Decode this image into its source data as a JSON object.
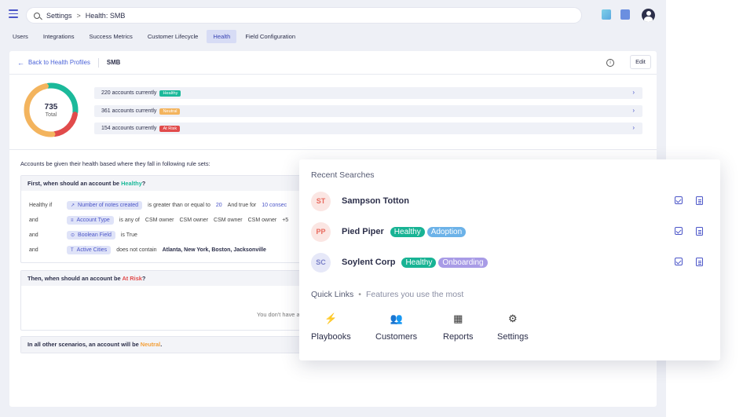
{
  "search": {
    "crumb1": "Settings",
    "sep": ">",
    "crumb2": "Health: SMB"
  },
  "tabs": [
    {
      "label": "Users"
    },
    {
      "label": "Integrations"
    },
    {
      "label": "Success Metrics"
    },
    {
      "label": "Customer Lifecycle"
    },
    {
      "label": "Health",
      "active": true
    },
    {
      "label": "Field Configuration"
    }
  ],
  "panel": {
    "back_label": "Back to Health Profiles",
    "title": "SMB",
    "info_icon": "i",
    "edit_label": "Edit"
  },
  "donut": {
    "total": "735",
    "total_label": "Total",
    "segments": [
      {
        "name": "healthy",
        "value": 220,
        "color": "#1bb99a"
      },
      {
        "name": "at-risk",
        "value": 154,
        "color": "#e14b4b"
      },
      {
        "name": "neutral",
        "value": 361,
        "color": "#f3b45e"
      }
    ]
  },
  "accounts": [
    {
      "text": "220 accounts currently",
      "badge": "Healthy",
      "kind": "healthy"
    },
    {
      "text": "361 accounts currently",
      "badge": "Neutral",
      "kind": "neutral"
    },
    {
      "text": "154 accounts currently",
      "badge": "At Risk",
      "kind": "atrisk"
    }
  ],
  "chevron": "›",
  "rules": {
    "intro": "Accounts be given their health based where they fall in following rule sets:",
    "healthy_q_pre": "First, when should an account be ",
    "healthy_q_hl": "Healthy",
    "healthy_q_post": "?",
    "risk_q_pre": "Then, when should an account be ",
    "risk_q_hl": "At Risk",
    "risk_q_post": "?",
    "empty_msg": "You don't have any",
    "neutral_pre": "In all other scenarios, an account will be ",
    "neutral_hl": "Neutral",
    "neutral_post": ".",
    "conditions": {
      "c1": {
        "lead": "Healthy if",
        "chip": "Number of notes created",
        "op": "is greater than or equal to",
        "num": "20",
        "and_txt": "And true for",
        "num2": "10 consec"
      },
      "c2": {
        "lead": "and",
        "chip": "Account Type",
        "op": "is any of",
        "v1": "CSM owner",
        "v2": "CSM owner",
        "v3": "CSM owner",
        "v4": "CSM owner",
        "more": "+5"
      },
      "c3": {
        "lead": "and",
        "chip": "Boolean Field",
        "op": "is True"
      },
      "c4": {
        "lead": "and",
        "chip": "Active Cities",
        "op": "does not contain",
        "val": "Atlanta, New York, Boston, Jacksonville"
      }
    }
  },
  "overlay": {
    "title": "Recent Searches",
    "results": [
      {
        "initials": "ST",
        "name": "Sampson Totton",
        "tags": []
      },
      {
        "initials": "PP",
        "name": "Pied Piper",
        "tags": [
          "Healthy",
          "Adoption"
        ]
      },
      {
        "initials": "SC",
        "name": "Soylent Corp",
        "tags": [
          "Healthy",
          "Onboarding"
        ]
      }
    ],
    "quick_links_title": "Quick Links",
    "quick_links_dot": "•",
    "quick_links_sub": "Features you use the most",
    "quick_actions": [
      {
        "label": "Playbooks",
        "icon": "⚡"
      },
      {
        "label": "Customers",
        "icon": "👥"
      },
      {
        "label": "Reports",
        "icon": "▦"
      },
      {
        "label": "Settings",
        "icon": "⚙"
      }
    ]
  }
}
